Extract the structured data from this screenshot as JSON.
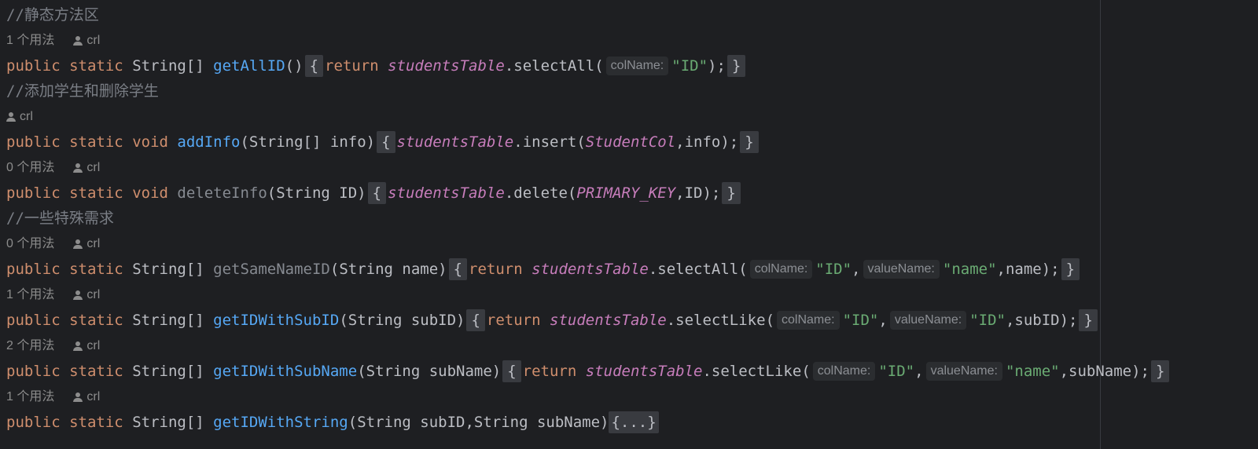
{
  "comments": {
    "static_section": "//静态方法区",
    "add_delete": "//添加学生和删除学生",
    "special": "//一些特殊需求"
  },
  "author": "crl",
  "usages": {
    "get_all_id": "1 个用法",
    "delete_info": "0 个用法",
    "get_same_name_id": "0 个用法",
    "get_id_with_sub_id": "1 个用法",
    "get_id_with_sub_name": "2 个用法",
    "get_id_with_string": "1 个用法"
  },
  "tokens": {
    "public": "public",
    "static": "static",
    "return": "return",
    "void": "void",
    "string_arr": "String[]",
    "string": "String",
    "open_brace": "{",
    "close_brace": "}",
    "folded_body": "{...}",
    "table": "studentsTable"
  },
  "hints": {
    "col_name": "colName:",
    "value_name": "valueName:"
  },
  "methods": {
    "get_all_id": {
      "name": "getAllID",
      "params": "()",
      "call": ".selectAll(",
      "arg1": "\"ID\"",
      "tail": ");"
    },
    "add_info": {
      "name": "addInfo",
      "params": "(String[] info)",
      "call": ".insert(",
      "const": "StudentCol",
      "tail": ",info);"
    },
    "delete_info": {
      "name": "deleteInfo",
      "params": "(String ID)",
      "call": ".delete(",
      "const": "PRIMARY_KEY",
      "tail": ",ID);"
    },
    "get_same_name_id": {
      "name": "getSameNameID",
      "params": "(String name)",
      "call": ".selectAll(",
      "arg1": "\"ID\"",
      "arg2": "\"name\"",
      "tail": ",name);"
    },
    "get_id_with_sub_id": {
      "name": "getIDWithSubID",
      "params": "(String subID)",
      "call": ".selectLike(",
      "arg1": "\"ID\"",
      "arg2": "\"ID\"",
      "tail": ",subID);"
    },
    "get_id_with_sub_name": {
      "name": "getIDWithSubName",
      "params": "(String subName)",
      "call": ".selectLike(",
      "arg1": "\"ID\"",
      "arg2": "\"name\"",
      "tail": ",subName);"
    },
    "get_id_with_string": {
      "name": "getIDWithString",
      "params": "(String subID,String subName)"
    }
  },
  "colors": {
    "background": "#1e1f22",
    "keyword": "#cf8e6d",
    "function": "#56a8f5",
    "field": "#c77dbb",
    "string": "#6aab73",
    "comment": "#7a7e85"
  }
}
